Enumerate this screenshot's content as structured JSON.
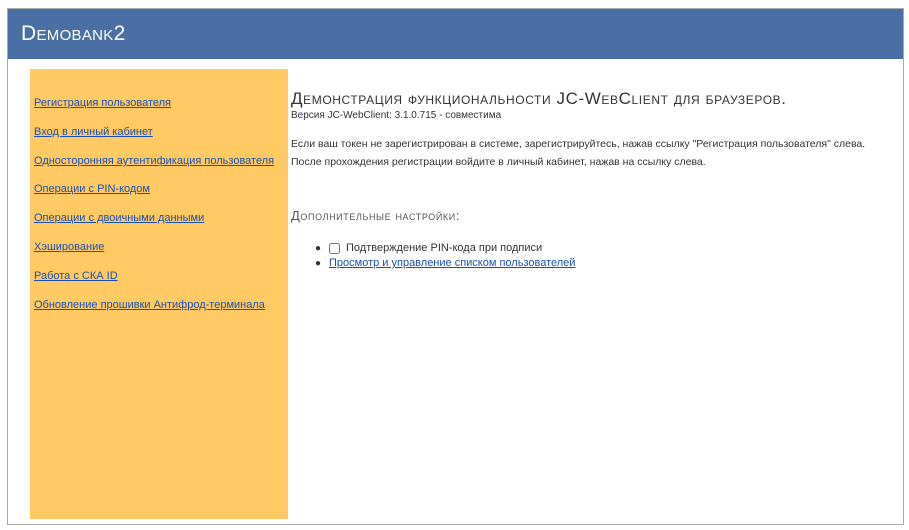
{
  "header": {
    "brand": "Demobank2"
  },
  "sidebar": {
    "items": [
      {
        "label": "Регистрация пользователя"
      },
      {
        "label": "Вход в личный кабинет"
      },
      {
        "label": "Односторонняя аутентификация пользователя"
      },
      {
        "label": "Операции с PIN-кодом"
      },
      {
        "label": "Операции с двоичными данными"
      },
      {
        "label": "Хэширование"
      },
      {
        "label": "Работа с СКА ID"
      },
      {
        "label": "Обновление прошивки Антифрод-терминала"
      }
    ]
  },
  "main": {
    "title": "Демонстрация функциональности JC-WebClient для браузеров.",
    "version": "Версия JC-WebClient: 3.1.0.715 - совместима",
    "info_line1": "Если ваш токен не зарегистрирован в системе, зарегистрируйтесь, нажав ссылку \"Регистрация пользователя\" слева.",
    "info_line2": "После прохождения регистрации войдите в личный кабинет, нажав на ссылку слева.",
    "settings_title": "Дополнительные настройки:",
    "pin_confirm_label": "Подтверждение PIN-кода при подписи",
    "pin_confirm_checked": false,
    "users_link": "Просмотр и управление списком пользователей"
  },
  "colors": {
    "header_bg": "#4a6fa5",
    "sidebar_bg": "#ffca64",
    "link": "#1a4fb0"
  }
}
